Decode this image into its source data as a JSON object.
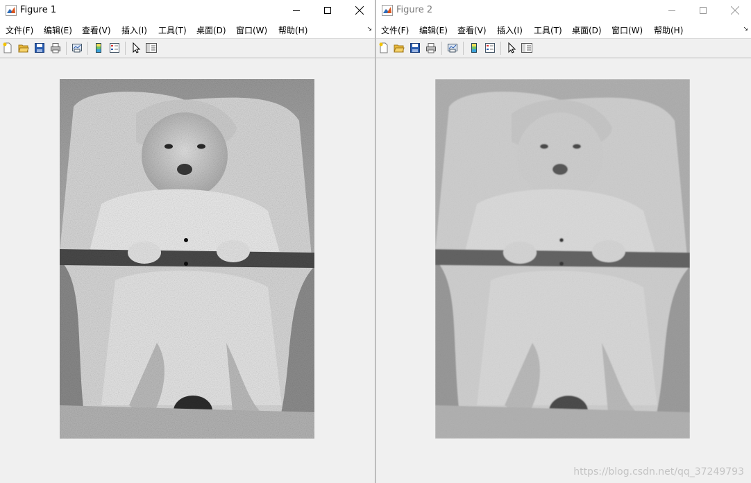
{
  "windows": [
    {
      "title": "Figure 1",
      "menu": [
        "文件(F)",
        "编辑(E)",
        "查看(V)",
        "插入(I)",
        "工具(T)",
        "桌面(D)",
        "窗口(W)",
        "帮助(H)"
      ],
      "image": {
        "noise_level": "high",
        "contrast": "high"
      }
    },
    {
      "title": "Figure 2",
      "menu": [
        "文件(F)",
        "编辑(E)",
        "查看(V)",
        "插入(I)",
        "工具(T)",
        "桌面(D)",
        "窗口(W)",
        "帮助(H)"
      ],
      "image": {
        "noise_level": "low",
        "contrast": "reduced"
      }
    }
  ],
  "toolbar_icons": [
    "new-figure-icon",
    "open-file-icon",
    "save-icon",
    "print-icon",
    "link-plot-icon",
    "insert-colorbar-icon",
    "insert-legend-icon",
    "edit-plot-icon",
    "property-inspector-icon"
  ],
  "menu_overflow_arrow": "↘",
  "watermark": "https://blog.csdn.net/qq_37249793",
  "colors": {
    "titlebar": "#ffffff",
    "window_bg": "#f0f0f0",
    "matlab_icon": "#d9541e"
  }
}
